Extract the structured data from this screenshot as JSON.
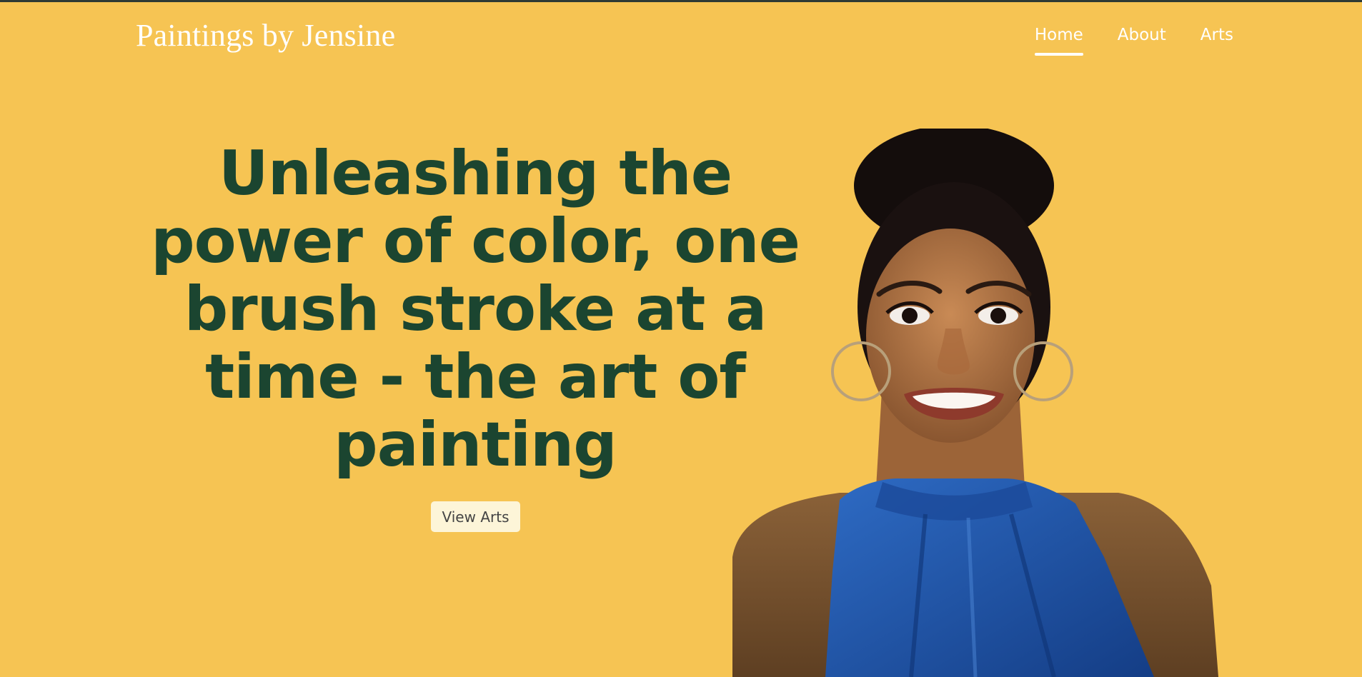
{
  "site": {
    "brand": "Paintings by Jensine"
  },
  "nav": {
    "items": [
      {
        "label": "Home",
        "active": true
      },
      {
        "label": "About",
        "active": false
      },
      {
        "label": "Arts",
        "active": false
      }
    ]
  },
  "hero": {
    "heading": "Unleashing the power of color, one brush stroke at a time - the art of painting",
    "cta_label": "View Arts",
    "image": "portrait-illustration"
  },
  "colors": {
    "background": "#f6c453",
    "heading": "#1b4530",
    "nav_text": "#ffffff",
    "button_bg": "#fdf5d8",
    "dress": "#1f56a8"
  }
}
